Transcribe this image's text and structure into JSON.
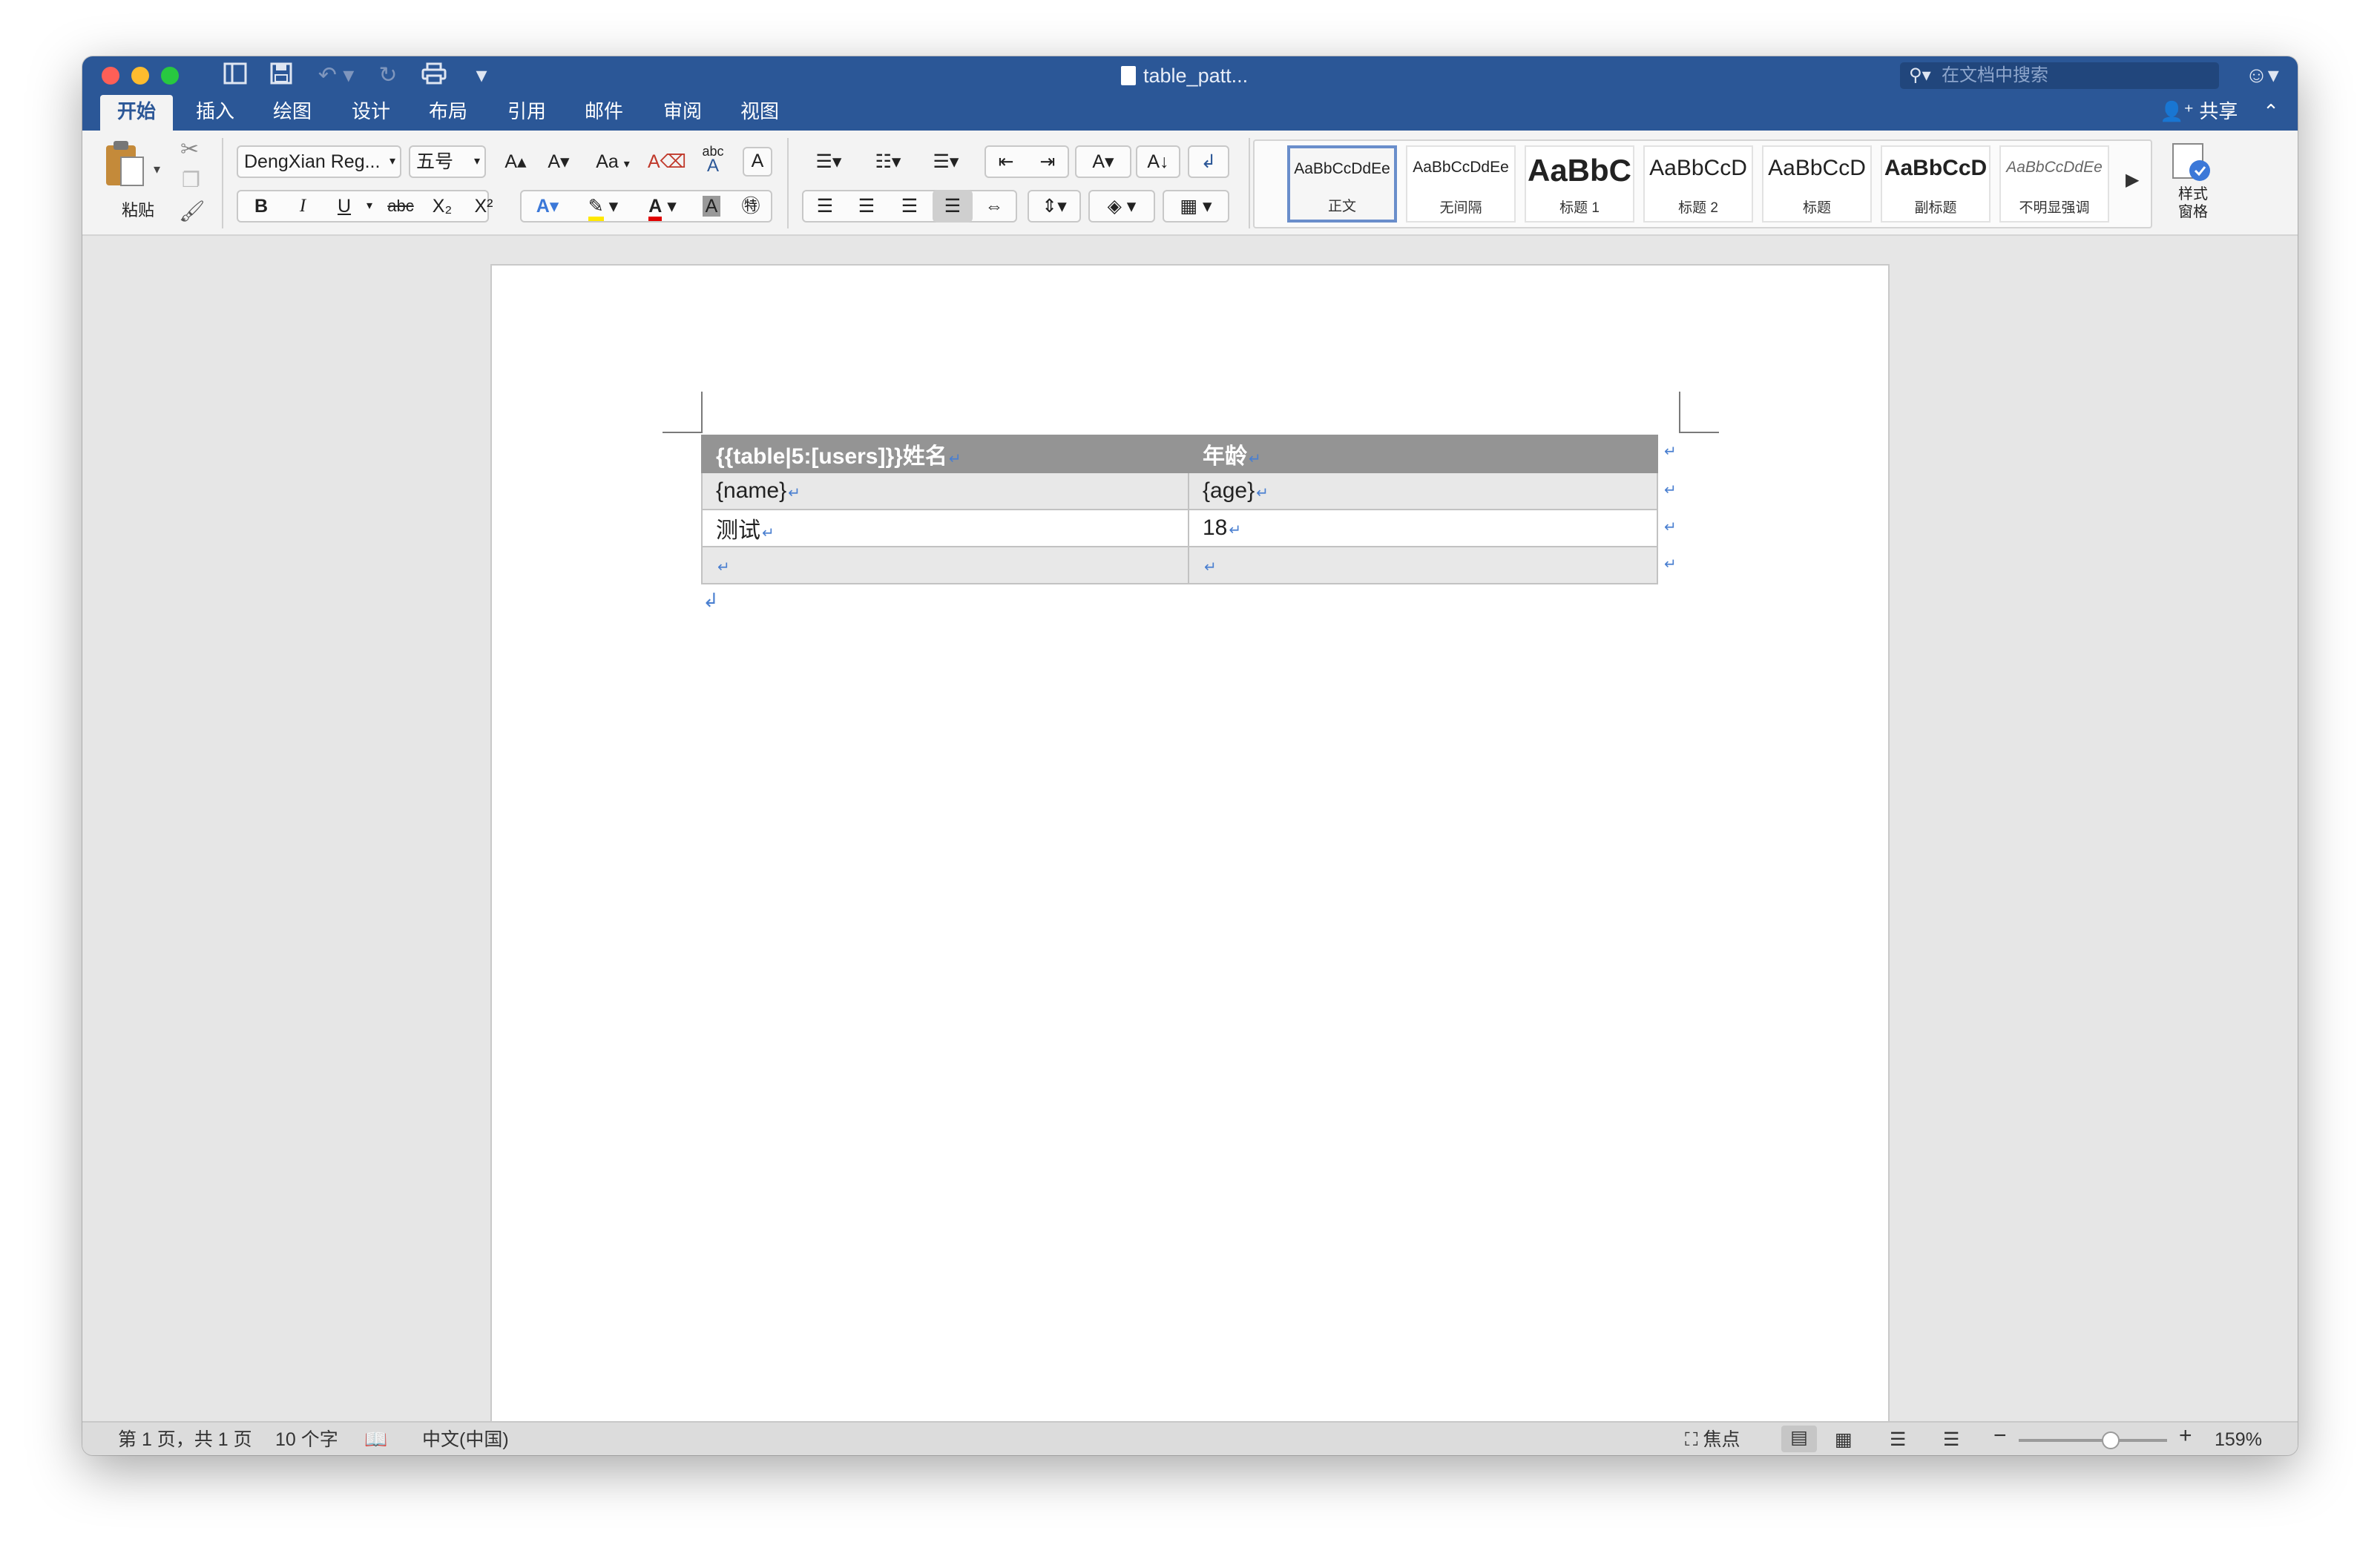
{
  "window": {
    "doc_title": "table_patt...",
    "search_placeholder": "在文档中搜索",
    "share_label": "共享"
  },
  "tabs": [
    {
      "label": "开始",
      "active": true
    },
    {
      "label": "插入"
    },
    {
      "label": "绘图"
    },
    {
      "label": "设计"
    },
    {
      "label": "布局"
    },
    {
      "label": "引用"
    },
    {
      "label": "邮件"
    },
    {
      "label": "审阅"
    },
    {
      "label": "视图"
    }
  ],
  "ribbon": {
    "paste_label": "粘贴",
    "font_name": "DengXian Reg...",
    "font_size": "五号",
    "bold": "B",
    "italic": "I",
    "underline": "U",
    "strike": "abc",
    "subscript": "X₂",
    "superscript": "X²",
    "grow_font": "A▴",
    "shrink_font": "A▾",
    "change_case": "Aa",
    "phonetic": "abc",
    "char_border": "A",
    "styles": [
      {
        "preview": "AaBbCcDdEe",
        "label": "正文",
        "selected": true
      },
      {
        "preview": "AaBbCcDdEe",
        "label": "无间隔"
      },
      {
        "preview": "AaBbC",
        "label": "标题 1"
      },
      {
        "preview": "AaBbCcD",
        "label": "标题 2"
      },
      {
        "preview": "AaBbCcD",
        "label": "标题"
      },
      {
        "preview": "AaBbCcD",
        "label": "副标题"
      },
      {
        "preview": "AaBbCcDdEe",
        "label": "不明显强调"
      }
    ],
    "styles_pane_label_1": "样式",
    "styles_pane_label_2": "窗格"
  },
  "table": {
    "rows": [
      [
        "{{table|5:[users]}}姓名",
        "年龄"
      ],
      [
        "{name}",
        "{age}"
      ],
      [
        "测试",
        "18"
      ],
      [
        "",
        ""
      ]
    ]
  },
  "status": {
    "page": "第 1 页，共 1 页",
    "words": "10 个字",
    "language": "中文(中国)",
    "focus": "焦点",
    "zoom": "159%",
    "zoom_level": 0.62
  },
  "colors": {
    "titlebar": "#2b5797",
    "header_row": "#949494",
    "accent": "#4a7fd0"
  }
}
